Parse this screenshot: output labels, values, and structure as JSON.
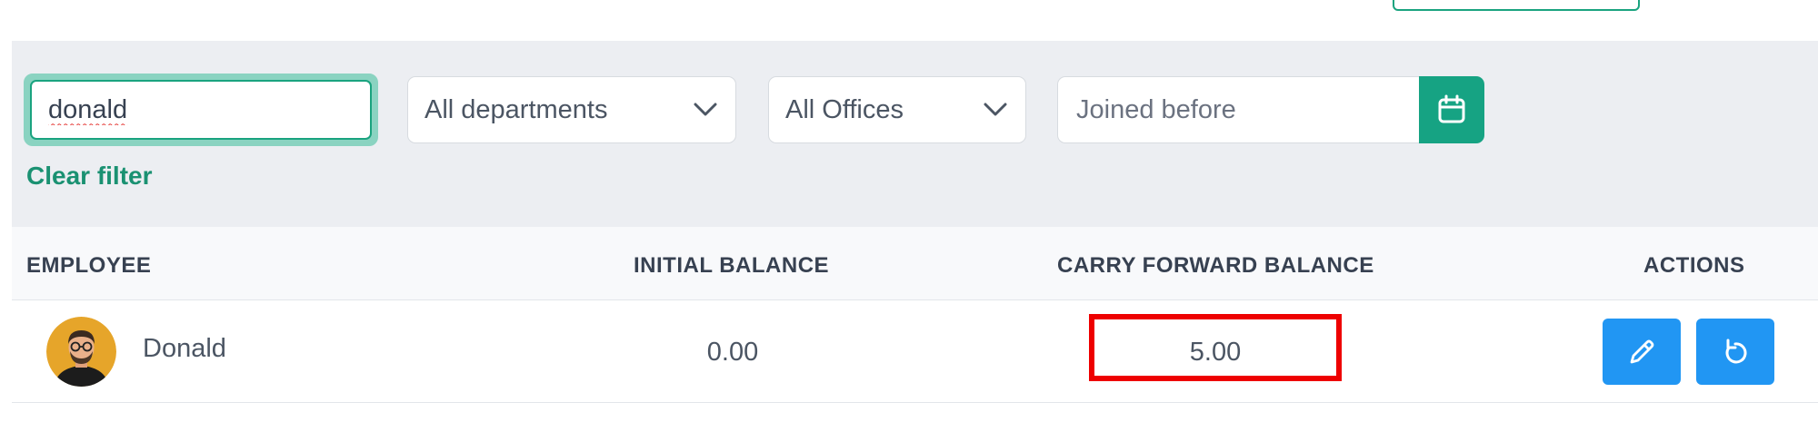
{
  "filters": {
    "search_value": "donald",
    "department_select": "All departments",
    "office_select": "All Offices",
    "joined_placeholder": "Joined before",
    "clear_filter_label": "Clear filter"
  },
  "table": {
    "headers": {
      "employee": "EMPLOYEE",
      "initial_balance": "INITIAL BALANCE",
      "carry_forward_balance": "CARRY FORWARD BALANCE",
      "actions": "ACTIONS"
    },
    "rows": [
      {
        "name": "Donald",
        "initial_balance": "0.00",
        "carry_forward_balance": "5.00"
      }
    ]
  },
  "icons": {
    "date_button": "calendar-icon",
    "edit_button": "pencil-icon",
    "reset_button": "undo-icon",
    "dropdown": "chevron-down-icon"
  },
  "colors": {
    "accent_green": "#16a383",
    "action_blue": "#2196f3",
    "highlight_red": "#ee0000",
    "panel_gray": "#eceef2"
  }
}
